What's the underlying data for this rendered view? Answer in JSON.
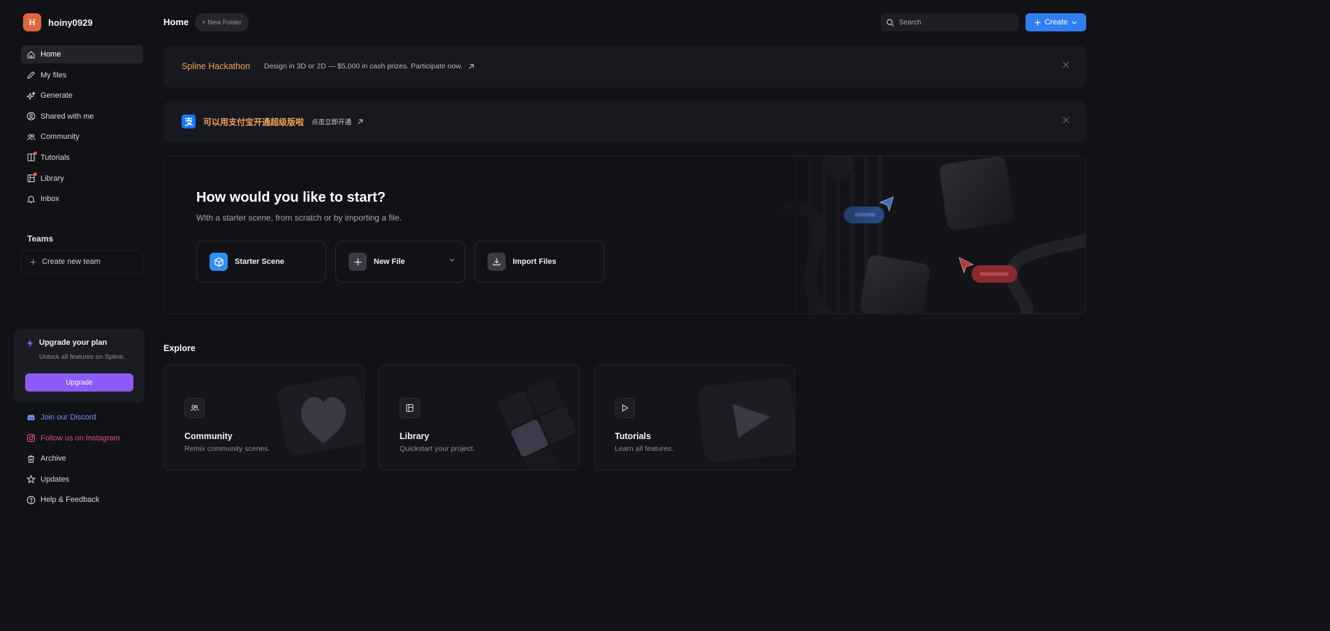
{
  "user": {
    "initial": "H",
    "name": "hoiny0929",
    "avatar_color": "#e0663e"
  },
  "sidebar": {
    "items": [
      {
        "label": "Home",
        "icon": "home-icon",
        "active": true
      },
      {
        "label": "My files",
        "icon": "pencil-icon"
      },
      {
        "label": "Generate",
        "icon": "sparkles-icon"
      },
      {
        "label": "Shared with me",
        "icon": "user-circle-icon"
      },
      {
        "label": "Community",
        "icon": "users-icon"
      },
      {
        "label": "Tutorials",
        "icon": "book-icon",
        "dot": true
      },
      {
        "label": "Library",
        "icon": "library-icon",
        "dot": true
      },
      {
        "label": "Inbox",
        "icon": "bell-icon"
      }
    ],
    "teams_title": "Teams",
    "create_team": "Create new team",
    "upgrade": {
      "title": "Upgrade your plan",
      "subtitle": "Unlock all features on Spline.",
      "button": "Upgrade",
      "button_color": "#8b5cf6"
    },
    "footer": [
      {
        "label": "Join our Discord",
        "icon": "discord-icon"
      },
      {
        "label": "Follow us on Instagram",
        "icon": "instagram-icon"
      },
      {
        "label": "Archive",
        "icon": "trash-icon"
      },
      {
        "label": "Updates",
        "icon": "star-icon"
      },
      {
        "label": "Help & Feedback",
        "icon": "help-icon"
      }
    ]
  },
  "header": {
    "title": "Home",
    "new_folder": "+ New Folder",
    "search_placeholder": "Search",
    "create": "Create",
    "accent": "#2f7ff0"
  },
  "banners": {
    "hackathon": {
      "title": "Spline Hackathon",
      "text": "Design in 3D or 2D — $5,000 in cash prizes. Participate now."
    },
    "alipay": {
      "title": "可以用支付宝开通超级版啦",
      "text": "点击立即开通"
    }
  },
  "start": {
    "title": "How would you like to start?",
    "subtitle": "With a starter scene, from scratch or by importing a file.",
    "options": [
      {
        "label": "Starter Scene",
        "icon": "cube-icon"
      },
      {
        "label": "New File",
        "icon": "plus-icon"
      },
      {
        "label": "Import Files",
        "icon": "download-icon"
      }
    ]
  },
  "explore": {
    "title": "Explore",
    "cards": [
      {
        "title": "Community",
        "subtitle": "Remix community scenes.",
        "icon": "users-icon"
      },
      {
        "title": "Library",
        "subtitle": "Quickstart your project.",
        "icon": "library-icon"
      },
      {
        "title": "Tutorials",
        "subtitle": "Learn all features.",
        "icon": "play-icon"
      }
    ]
  }
}
